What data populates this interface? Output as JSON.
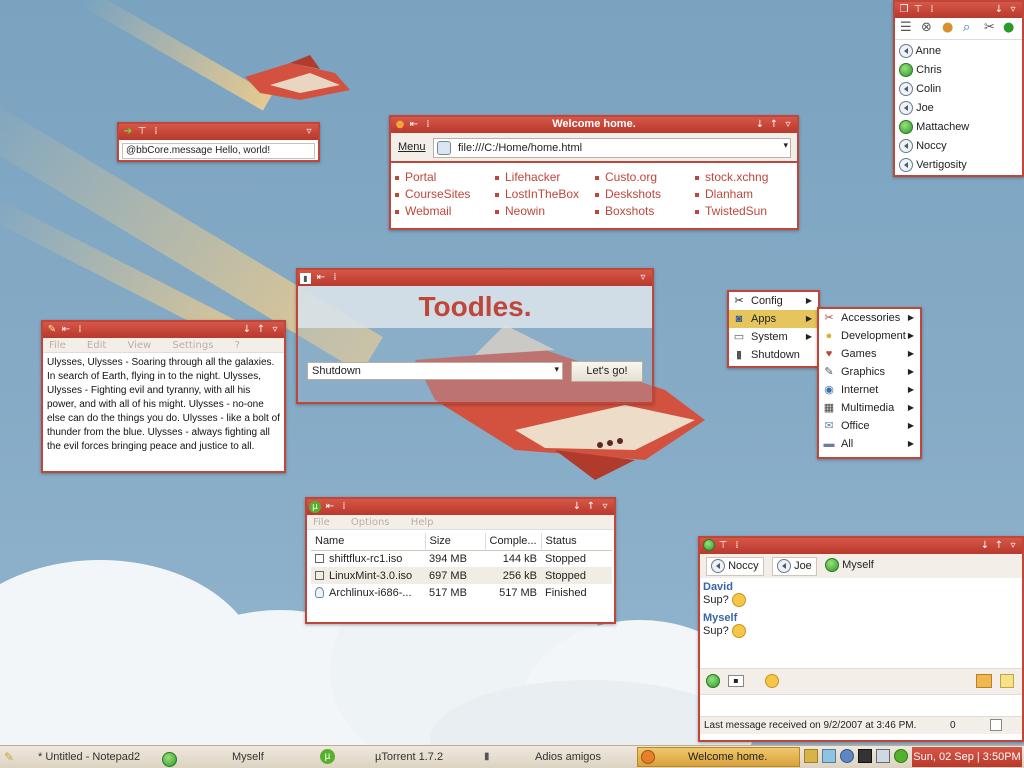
{
  "bbcore": {
    "command": "@bbCore.message Hello, world!"
  },
  "browser": {
    "title": "Welcome home.",
    "menu_label": "Menu",
    "url": "file:///C:/Home/home.html",
    "links": [
      [
        "Portal",
        "CourseSites",
        "Webmail"
      ],
      [
        "Lifehacker",
        "LostInTheBox",
        "Neowin"
      ],
      [
        "Custo.org",
        "Deskshots",
        "Boxshots"
      ],
      [
        "stock.xchng",
        "Dlanham",
        "TwistedSun"
      ]
    ]
  },
  "toodles": {
    "title": "Toodles.",
    "select_value": "Shutdown",
    "go_label": "Let's go!"
  },
  "notepad": {
    "menu": [
      "File",
      "Edit",
      "View",
      "Settings",
      "?"
    ],
    "text": "Ulysses, Ulysses - Soaring through all the galaxies. In search of Earth, flying in to the night. Ulysses, Ulysses - Fighting evil and tyranny, with all his power, and with all of his might. Ulysses - no-one else can do the things you do. Ulysses - like a bolt of thunder from the blue. Ulysses - always fighting all the evil forces bringing peace and justice to all."
  },
  "start_menu": {
    "items": [
      {
        "label": "Config",
        "icon": "tools-icon"
      },
      {
        "label": "Apps",
        "icon": "apps-icon"
      },
      {
        "label": "System",
        "icon": "system-icon"
      },
      {
        "label": "Shutdown",
        "icon": "shutdown-icon"
      }
    ],
    "apps_submenu": [
      {
        "label": "Accessories",
        "icon": "accessories-icon"
      },
      {
        "label": "Development",
        "icon": "development-icon"
      },
      {
        "label": "Games",
        "icon": "games-icon"
      },
      {
        "label": "Graphics",
        "icon": "graphics-icon"
      },
      {
        "label": "Internet",
        "icon": "internet-icon"
      },
      {
        "label": "Multimedia",
        "icon": "multimedia-icon"
      },
      {
        "label": "Office",
        "icon": "office-icon"
      },
      {
        "label": "All",
        "icon": "folder-icon"
      }
    ]
  },
  "utorrent": {
    "menu": [
      "File",
      "Options",
      "Help"
    ],
    "columns": [
      "Name",
      "Size",
      "Comple...",
      "Status"
    ],
    "rows": [
      {
        "name": "shiftflux-rc1.iso",
        "size": "394 MB",
        "done": "144 kB",
        "status": "Stopped"
      },
      {
        "name": "LinuxMint-3.0.iso",
        "size": "697 MB",
        "done": "256 kB",
        "status": "Stopped"
      },
      {
        "name": "Archlinux-i686-...",
        "size": "517 MB",
        "done": "517 MB",
        "status": "Finished"
      }
    ]
  },
  "buddy_list": {
    "contacts": [
      {
        "name": "Anne",
        "status": "away"
      },
      {
        "name": "Chris",
        "status": "online"
      },
      {
        "name": "Colin",
        "status": "away"
      },
      {
        "name": "Joe",
        "status": "away"
      },
      {
        "name": "Mattachew",
        "status": "online"
      },
      {
        "name": "Noccy",
        "status": "away"
      },
      {
        "name": "Vertigosity",
        "status": "away"
      }
    ]
  },
  "chat": {
    "tabs": [
      "Noccy",
      "Joe",
      "Myself"
    ],
    "messages": [
      {
        "sender": "David",
        "text": "Sup?"
      },
      {
        "sender": "Myself",
        "text": "Sup?"
      }
    ],
    "status_text": "Last message received on 9/2/2007 at 3:46 PM.",
    "char_count": "0"
  },
  "taskbar": {
    "tasks": [
      "* Untitled - Notepad2",
      "Myself",
      "µTorrent 1.7.2",
      "Adios amigos",
      "Welcome home."
    ],
    "clock": "Sun, 02 Sep | 3:50PM"
  },
  "colors": {
    "accent": "#c0463a",
    "desktop": "#84a8c3",
    "highlight": "#e6c55d"
  }
}
